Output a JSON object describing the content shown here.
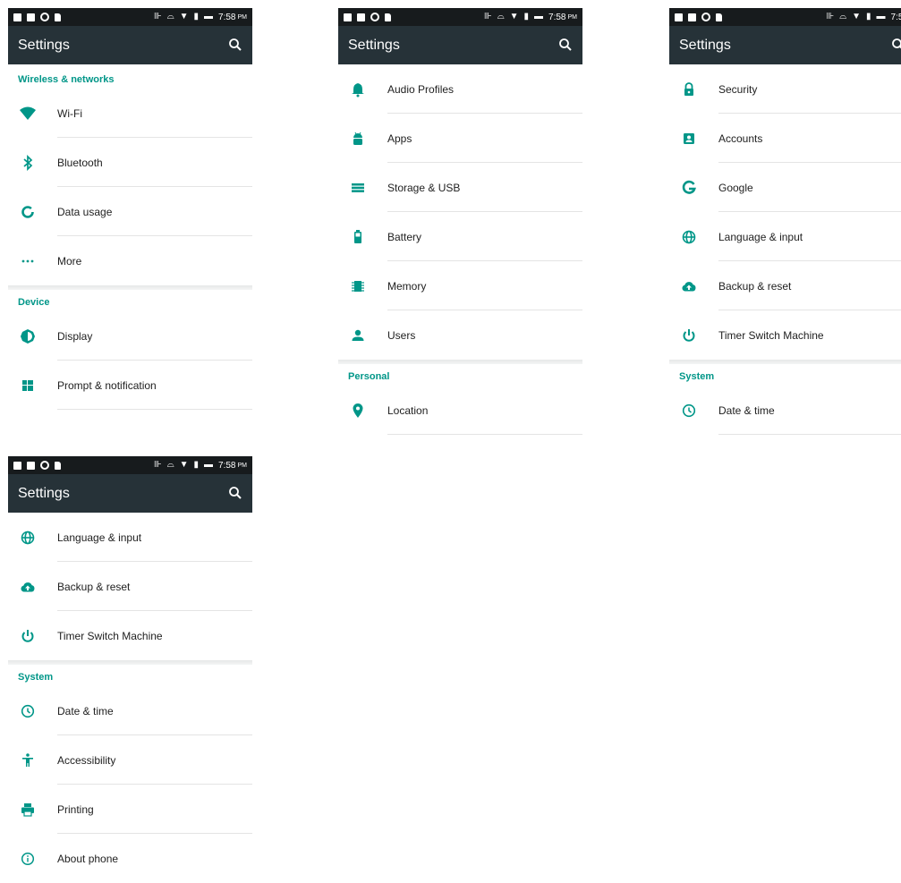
{
  "status": {
    "time": "7:58",
    "ampm": "PM"
  },
  "toolbar": {
    "title": "Settings"
  },
  "colors": {
    "accent": "#009688",
    "toolbar": "#263238",
    "statusbar": "#171b1d"
  },
  "panel1": {
    "section_wireless": "Wireless & networks",
    "wifi": "Wi-Fi",
    "bluetooth": "Bluetooth",
    "data_usage": "Data usage",
    "more": "More",
    "section_device": "Device",
    "display": "Display",
    "prompt": "Prompt & notification"
  },
  "panel2": {
    "audio": "Audio Profiles",
    "apps": "Apps",
    "storage": "Storage & USB",
    "battery": "Battery",
    "memory": "Memory",
    "users": "Users",
    "section_personal": "Personal",
    "location": "Location"
  },
  "panel3": {
    "security": "Security",
    "accounts": "Accounts",
    "google": "Google",
    "language": "Language & input",
    "backup": "Backup & reset",
    "timer": "Timer Switch Machine",
    "section_system": "System",
    "datetime": "Date & time"
  },
  "panel4": {
    "language": "Language & input",
    "backup": "Backup & reset",
    "timer": "Timer Switch Machine",
    "section_system": "System",
    "datetime": "Date & time",
    "accessibility": "Accessibility",
    "printing": "Printing",
    "about": "About phone"
  }
}
